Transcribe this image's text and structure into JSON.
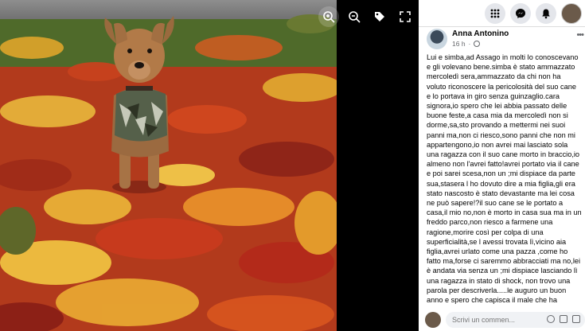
{
  "viewer": {
    "photo_alt": "dog-sitting-on-autumn-leaves",
    "tools": [
      "zoom-in-icon",
      "zoom-out-icon",
      "tag-icon",
      "fullscreen-icon"
    ]
  },
  "header": {
    "icons": [
      "menu-grid-icon",
      "messenger-icon",
      "notifications-icon"
    ]
  },
  "post": {
    "author": "Anna Antonino",
    "time": "16 h",
    "text": "Lui e simba,ad Assago in molti lo conoscevano e gli volevano bene.simba è stato ammazzato mercoledì sera,ammazzato da chi non ha voluto riconoscere la pericolosità del suo cane e lo portava in giro senza guinzaglio.cara signora,io spero che lei abbia passato delle buone feste,a casa mia da mercoledì non si dorme,sa,sto provando a mettermi nei suoi panni ma,non ci riesco,sono panni che non mi appartengono,io non avrei mai lasciato sola una ragazza con il suo cane morto in braccio,io almeno non l'avrei fatto!avrei portato via il cane e poi sarei scesa,non un ;mi dispiace da parte sua,stasera l ho dovuto dire a mia figlia,gli era stato nascosto è stato devastante ma lei cosa ne può sapere!?il suo cane se le portato a casa,il mio no,non è morto in casa sua ma in un freddo parco,non riesco a farmene una ragione,morire così per colpa di una superficialità,se l avessi trovata lì,vicino aia figlia,avrei urlato come una pazza ,come ho fatto ma,forse ci saremmo abbracciati ma no,lei è andata via senza un ;mi dispiace lasciando lì una ragazza in stato di shock, non trovo una parola per descriverla.....le auguro un buon anno e spero che capisca il male che ha"
  },
  "comment": {
    "placeholder": "Scrivi un commen..."
  },
  "colors": {
    "fb_blue": "#1877f2",
    "panel_bg": "#ffffff",
    "viewer_bg": "#000000"
  }
}
